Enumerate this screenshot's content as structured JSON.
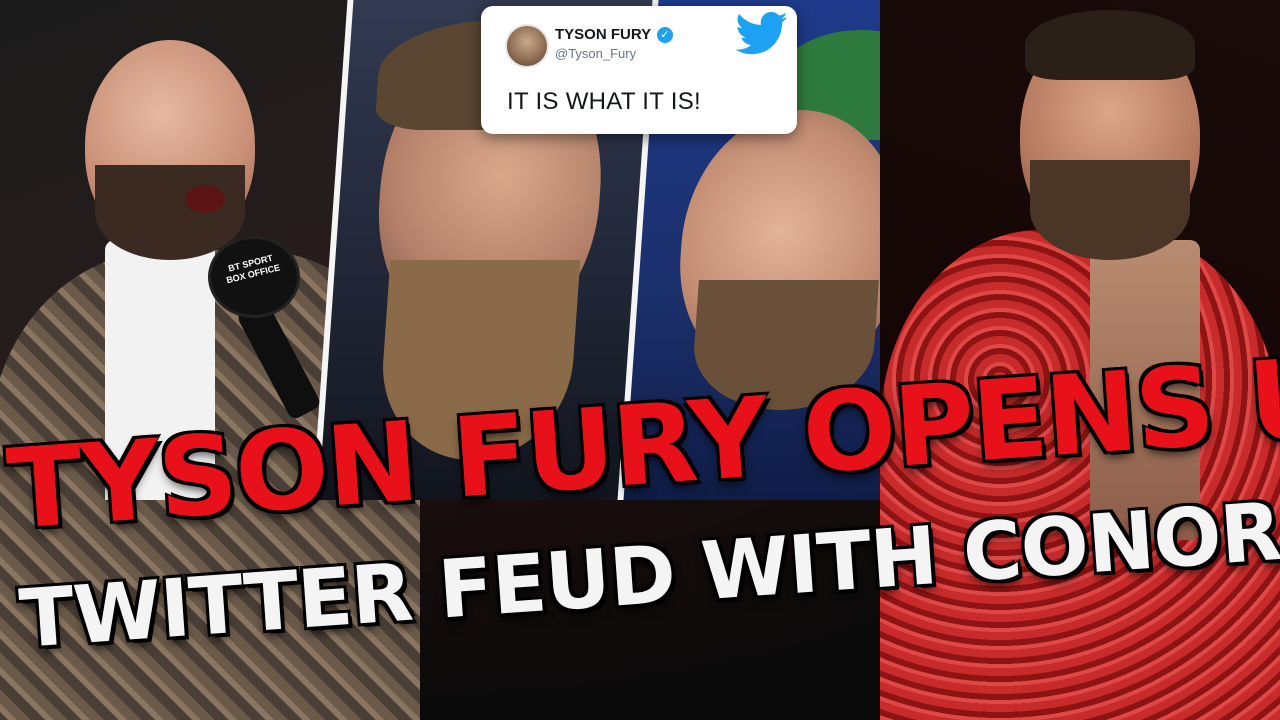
{
  "thumbnail": {
    "headline_line1": "TYSON FURY OPENS UP",
    "headline_line2": "TWITTER FEUD WITH CONOR MCGREGOR"
  },
  "tweet": {
    "display_name": "TYSON FURY",
    "handle": "@Tyson_Fury",
    "text": "IT IS WHAT IT IS!",
    "verified_icon": "verified-check-icon",
    "platform_icon": "twitter-bird-icon"
  },
  "microphone": {
    "label_line1": "BT SPORT",
    "label_line2": "BOX OFFICE"
  },
  "colors": {
    "headline_red": "#e8111a",
    "headline_white": "#f4f4f4",
    "twitter_blue": "#1da1f2"
  }
}
